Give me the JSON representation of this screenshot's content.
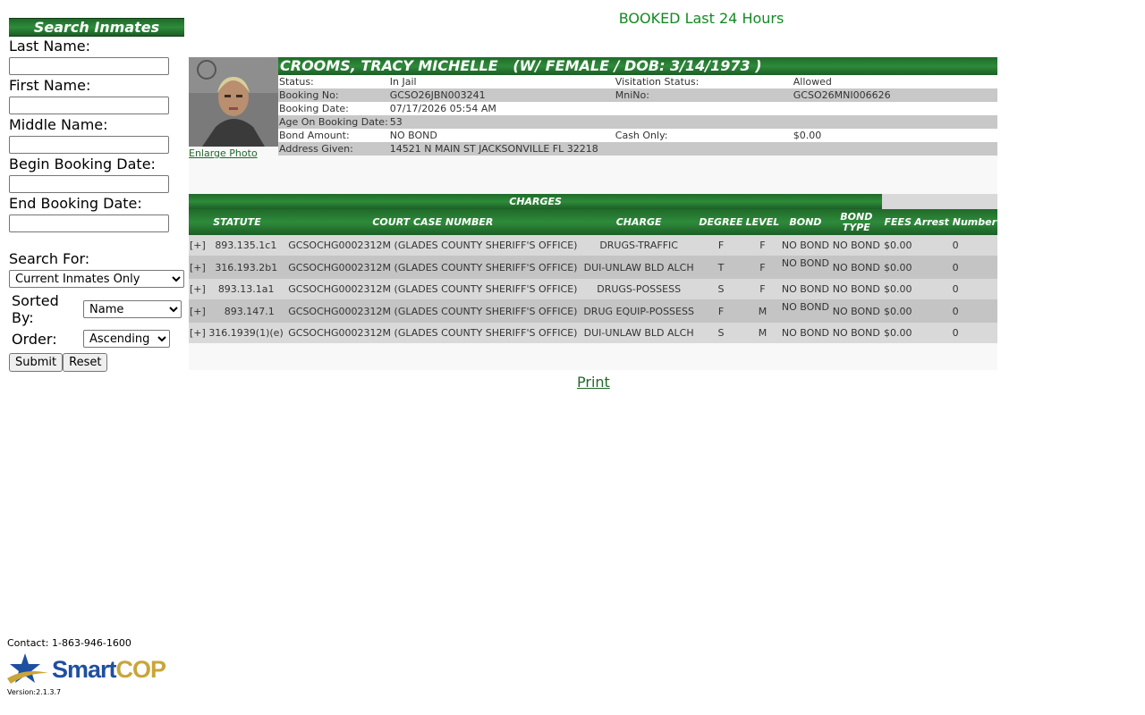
{
  "sidebar": {
    "title": "Search Inmates",
    "fields": [
      {
        "label": "Last Name:",
        "value": ""
      },
      {
        "label": "First Name:",
        "value": ""
      },
      {
        "label": "Middle Name:",
        "value": ""
      },
      {
        "label": "Begin Booking Date:",
        "value": ""
      },
      {
        "label": "End Booking Date:",
        "value": ""
      }
    ],
    "search_for_label": "Search For:",
    "search_for_value": "Current Inmates Only",
    "sorted_by_label": "Sorted By:",
    "sorted_by_value": "Name",
    "order_label": "Order:",
    "order_value": "Ascending",
    "submit_label": "Submit",
    "reset_label": "Reset"
  },
  "footer": {
    "contact": "Contact: 1-863-946-1600",
    "logo_smart": "Smart",
    "logo_cop": "COP",
    "version": "Version:2.1.3.7"
  },
  "page_heading": "BOOKED Last 24 Hours",
  "inmate": {
    "name_heading": "CROOMS, TRACY MICHELLE   (W/ FEMALE / DOB: 3/14/1973 )",
    "enlarge_photo": "Enlarge Photo",
    "info_rows": [
      {
        "k1": "Status:",
        "v1": "In Jail",
        "k2": "Visitation Status:",
        "v2": "Allowed"
      },
      {
        "k1": "Booking No:",
        "v1": "GCSO26JBN003241",
        "k2": "MniNo:",
        "v2": "GCSO26MNI006626"
      },
      {
        "k1": "Booking Date:",
        "v1": "07/17/2026 05:54 AM",
        "k2": "",
        "v2": ""
      },
      {
        "k1": "Age On Booking Date:",
        "v1": "53",
        "k2": "",
        "v2": ""
      },
      {
        "k1": "Bond Amount:",
        "v1": "NO BOND",
        "k2": "Cash Only:",
        "v2": "$0.00"
      },
      {
        "k1": "Address Given:",
        "v1": "14521 N MAIN ST JACKSONVILLE FL 32218",
        "k2": "",
        "v2": ""
      }
    ]
  },
  "charges": {
    "title": "CHARGES",
    "headers": {
      "statute": "STATUTE",
      "court_case": "COURT CASE NUMBER",
      "charge": "CHARGE",
      "degree": "DEGREE",
      "level": "LEVEL",
      "bond": "BOND",
      "bond_type": "BOND TYPE",
      "fees": "FEES",
      "arrest_number": "Arrest Number"
    },
    "rows": [
      {
        "expand": "[+]",
        "statute": "893.135.1c1",
        "court_case": "GCSOCHG0002312M (GLADES COUNTY SHERIFF'S OFFICE)",
        "charge": "DRUGS-TRAFFIC",
        "degree": "F",
        "level": "F",
        "bond": "NO BOND",
        "bond_type": "NO BOND",
        "fees": "$0.00",
        "arrest_number": "0"
      },
      {
        "expand": "[+]",
        "statute": "316.193.2b1",
        "court_case": "GCSOCHG0002312M (GLADES COUNTY SHERIFF'S OFFICE)",
        "charge": "DUI-UNLAW BLD ALCH",
        "degree": "T",
        "level": "F",
        "bond": "NO BOND",
        "bond_type": "NO BOND",
        "fees": "$0.00",
        "arrest_number": "0"
      },
      {
        "expand": "[+]",
        "statute": "893.13.1a1",
        "court_case": "GCSOCHG0002312M (GLADES COUNTY SHERIFF'S OFFICE)",
        "charge": "DRUGS-POSSESS",
        "degree": "S",
        "level": "F",
        "bond": "NO BOND",
        "bond_type": "NO BOND",
        "fees": "$0.00",
        "arrest_number": "0"
      },
      {
        "expand": "[+]",
        "statute": "893.147.1",
        "court_case": "GCSOCHG0002312M (GLADES COUNTY SHERIFF'S OFFICE)",
        "charge": "DRUG EQUIP-POSSESS",
        "degree": "F",
        "level": "M",
        "bond": "NO BOND",
        "bond_type": "NO BOND",
        "fees": "$0.00",
        "arrest_number": "0"
      },
      {
        "expand": "[+]",
        "statute": "316.1939(1)(e)",
        "court_case": "GCSOCHG0002312M (GLADES COUNTY SHERIFF'S OFFICE)",
        "charge": "DUI-UNLAW BLD ALCH",
        "degree": "S",
        "level": "M",
        "bond": "NO BOND",
        "bond_type": "NO BOND",
        "fees": "$0.00",
        "arrest_number": "0"
      }
    ]
  },
  "print_label": "Print"
}
